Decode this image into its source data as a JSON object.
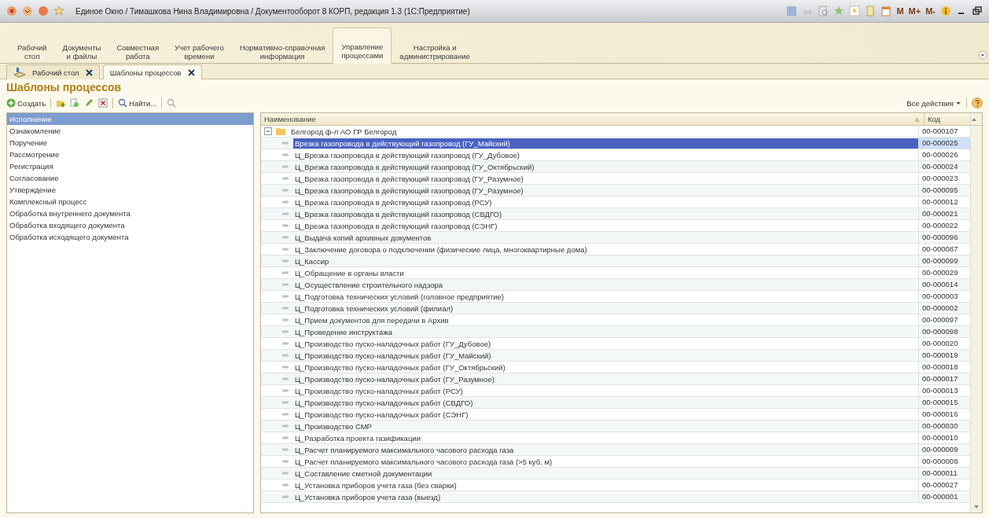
{
  "window": {
    "title": "Единое Окно / Тимашкова Нина Владимировна / Документооборот 8 КОРП, редакция 1.3  (1С:Предприятие)",
    "toolbar_buttons": [
      "M",
      "M+",
      "M-"
    ]
  },
  "sections": [
    {
      "label": "Рабочий\nстол",
      "selected": false
    },
    {
      "label": "Документы\nи файлы",
      "selected": false
    },
    {
      "label": "Совместная\nработа",
      "selected": false
    },
    {
      "label": "Учет рабочего\nвремени",
      "selected": false
    },
    {
      "label": "Нормативно-справочная\nинформация",
      "selected": false
    },
    {
      "label": "Управление\nпроцессами",
      "selected": true
    },
    {
      "label": "Настройка и\nадминистрирование",
      "selected": false
    }
  ],
  "tabs": [
    {
      "label": "Рабочий стол",
      "selected": false,
      "kind": "home"
    },
    {
      "label": "Шаблоны процессов",
      "selected": true,
      "kind": "form"
    }
  ],
  "page_title": "Шаблоны процессов",
  "toolbar": {
    "create": "Создать",
    "find": "Найти...",
    "all_actions": "Все действия"
  },
  "process_types": [
    {
      "label": "Исполнение",
      "selected": true
    },
    {
      "label": "Ознакомление",
      "selected": false
    },
    {
      "label": "Поручение",
      "selected": false
    },
    {
      "label": "Рассмотрение",
      "selected": false
    },
    {
      "label": "Регистрация",
      "selected": false
    },
    {
      "label": "Согласование",
      "selected": false
    },
    {
      "label": "Утверждение",
      "selected": false
    },
    {
      "label": "Комплексный процесс",
      "selected": false
    },
    {
      "label": "Обработка внутреннего документа",
      "selected": false
    },
    {
      "label": "Обработка входящего документа",
      "selected": false
    },
    {
      "label": "Обработка исходящего документа",
      "selected": false
    }
  ],
  "table": {
    "columns": [
      "Наименование",
      "Код"
    ],
    "group": {
      "name": "Белгород ф-л АО ГР Белгород",
      "code": "00-000107",
      "expanded": true,
      "children": [
        {
          "name": "Врезка газопровода в действующий газопровод (ГУ_Майский)",
          "code": "00-000025",
          "selected": true
        },
        {
          "name": "Ц_Врезка газопровода в действующий газопровод (ГУ_Дубовое)",
          "code": "00-000026",
          "selected": false
        },
        {
          "name": "Ц_Врезка газопровода в действующий газопровод (ГУ_Октябрьский)",
          "code": "00-000024",
          "selected": false
        },
        {
          "name": "Ц_Врезка газопровода в действующий газопровод (ГУ_Разумное)",
          "code": "00-000023",
          "selected": false
        },
        {
          "name": "Ц_Врезка газопровода в действующий газопровод (ГУ_Разумное)",
          "code": "00-000095",
          "selected": false
        },
        {
          "name": "Ц_Врезка газопровода в действующий газопровод (РСУ)",
          "code": "00-000012",
          "selected": false
        },
        {
          "name": "Ц_Врезка газопровода в действующий газопровод (СВДГО)",
          "code": "00-000021",
          "selected": false
        },
        {
          "name": "Ц_Врезка газопровода в действующий газопровод (СЭНГ)",
          "code": "00-000022",
          "selected": false
        },
        {
          "name": "Ц_Выдача копий архивных документов",
          "code": "00-000096",
          "selected": false
        },
        {
          "name": "Ц_Заключение договора о подключении (физические лица, многоквартирные дома)",
          "code": "00-000087",
          "selected": false
        },
        {
          "name": "Ц_Кассир",
          "code": "00-000099",
          "selected": false
        },
        {
          "name": "Ц_Обращение в органы власти",
          "code": "00-000029",
          "selected": false
        },
        {
          "name": "Ц_Осуществление строительного надзора",
          "code": "00-000014",
          "selected": false
        },
        {
          "name": "Ц_Подготовка технических условий (головное предприятие)",
          "code": "00-000003",
          "selected": false
        },
        {
          "name": "Ц_Подготовка технических условий (филиал)",
          "code": "00-000002",
          "selected": false
        },
        {
          "name": "Ц_Прием документов для передачи в Архив",
          "code": "00-000097",
          "selected": false
        },
        {
          "name": "Ц_Проведение инструктажа",
          "code": "00-000098",
          "selected": false
        },
        {
          "name": "Ц_Производство пуско-наладочных работ (ГУ_Дубовое)",
          "code": "00-000020",
          "selected": false
        },
        {
          "name": "Ц_Производство пуско-наладочных работ (ГУ_Майский)",
          "code": "00-000019",
          "selected": false
        },
        {
          "name": "Ц_Производство пуско-наладочных работ (ГУ_Октябрьский)",
          "code": "00-000018",
          "selected": false
        },
        {
          "name": "Ц_Производство пуско-наладочных работ (ГУ_Разумное)",
          "code": "00-000017",
          "selected": false
        },
        {
          "name": "Ц_Производство пуско-наладочных работ (РСУ)",
          "code": "00-000013",
          "selected": false
        },
        {
          "name": "Ц_Производство пуско-наладочных работ (СВДГО)",
          "code": "00-000015",
          "selected": false
        },
        {
          "name": "Ц_Производство пуско-наладочных работ (СЭНГ)",
          "code": "00-000016",
          "selected": false
        },
        {
          "name": "Ц_Производство СМР",
          "code": "00-000030",
          "selected": false
        },
        {
          "name": "Ц_Разработка проекта газификации",
          "code": "00-000010",
          "selected": false
        },
        {
          "name": "Ц_Расчет планируемого максимального часового расхода газа",
          "code": "00-000009",
          "selected": false
        },
        {
          "name": "Ц_Расчет планируемого максимального часового расхода газа (>5 куб. м)",
          "code": "00-000008",
          "selected": false
        },
        {
          "name": "Ц_Составление сметной документации",
          "code": "00-000011",
          "selected": false
        },
        {
          "name": "Ц_Установка приборов учета газа (без сварки)",
          "code": "00-000027",
          "selected": false
        },
        {
          "name": "Ц_Установка приборов учета газа (выезд)",
          "code": "00-000001",
          "selected": false
        }
      ]
    }
  }
}
